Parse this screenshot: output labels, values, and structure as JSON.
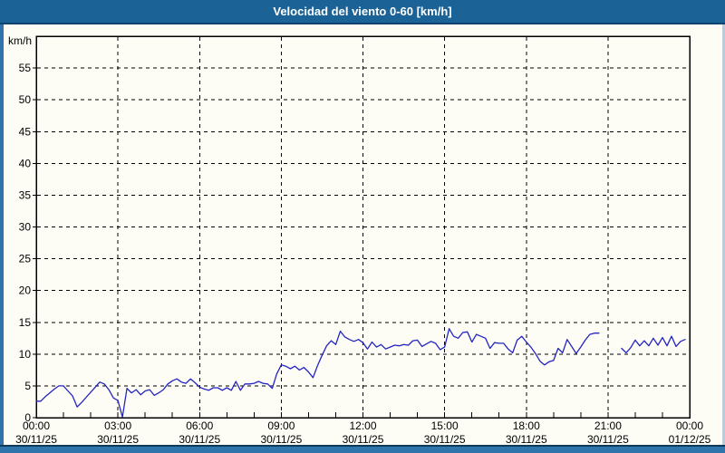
{
  "title_bar": {
    "text": "Velocidad del viento 0-60 [km/h]"
  },
  "colors": {
    "titlebar_bg": "#1b6296",
    "titlebar_text": "#ffffff",
    "window_border": "#2f74ab",
    "background": "#fdfdf6",
    "grid": "#000000",
    "line": "#2424c0"
  },
  "chart_data": {
    "type": "line",
    "title": "Velocidad del viento 0-60 [km/h]",
    "ylabel": "km/h",
    "ylim": [
      0,
      60
    ],
    "ytick_step": 5,
    "yticks": [
      0,
      5,
      10,
      15,
      20,
      25,
      30,
      35,
      40,
      45,
      50,
      55
    ],
    "x_range_hours": [
      0,
      24
    ],
    "x_minor_tick_hours": 1,
    "grid": "dashed, 3-hour vertical and 5 km/h horizontal",
    "legend_position": "none",
    "x_major_ticks": [
      {
        "hour": 0,
        "time": "00:00",
        "date": "30/11/25"
      },
      {
        "hour": 3,
        "time": "03:00",
        "date": "30/11/25"
      },
      {
        "hour": 6,
        "time": "06:00",
        "date": "30/11/25"
      },
      {
        "hour": 9,
        "time": "09:00",
        "date": "30/11/25"
      },
      {
        "hour": 12,
        "time": "12:00",
        "date": "30/11/25"
      },
      {
        "hour": 15,
        "time": "15:00",
        "date": "30/11/25"
      },
      {
        "hour": 18,
        "time": "18:00",
        "date": "30/11/25"
      },
      {
        "hour": 21,
        "time": "21:00",
        "date": "30/11/25"
      },
      {
        "hour": 24,
        "time": "00:00",
        "date": "01/12/25"
      }
    ],
    "series": [
      {
        "name": "Velocidad del viento",
        "color": "#2424c0",
        "units": "km/h",
        "points_format": "[minutes_since_00:00, km/h], null = data gap",
        "points": [
          [
            0,
            2.6
          ],
          [
            10,
            2.6
          ],
          [
            20,
            3.3
          ],
          [
            30,
            3.9
          ],
          [
            40,
            4.5
          ],
          [
            50,
            5.0
          ],
          [
            60,
            5.0
          ],
          [
            70,
            4.2
          ],
          [
            80,
            3.4
          ],
          [
            90,
            1.7
          ],
          [
            100,
            2.4
          ],
          [
            110,
            3.2
          ],
          [
            120,
            4.0
          ],
          [
            130,
            4.8
          ],
          [
            140,
            5.6
          ],
          [
            150,
            5.3
          ],
          [
            160,
            4.4
          ],
          [
            170,
            3.1
          ],
          [
            180,
            2.7
          ],
          [
            190,
            0.1
          ],
          [
            200,
            4.6
          ],
          [
            210,
            3.9
          ],
          [
            220,
            4.4
          ],
          [
            230,
            3.6
          ],
          [
            240,
            4.2
          ],
          [
            250,
            4.4
          ],
          [
            260,
            3.5
          ],
          [
            270,
            3.9
          ],
          [
            280,
            4.4
          ],
          [
            290,
            5.3
          ],
          [
            300,
            5.8
          ],
          [
            310,
            6.1
          ],
          [
            320,
            5.6
          ],
          [
            330,
            5.4
          ],
          [
            340,
            6.1
          ],
          [
            350,
            5.5
          ],
          [
            360,
            4.8
          ],
          [
            370,
            4.5
          ],
          [
            380,
            4.3
          ],
          [
            390,
            4.7
          ],
          [
            400,
            4.7
          ],
          [
            410,
            4.3
          ],
          [
            420,
            4.7
          ],
          [
            430,
            4.3
          ],
          [
            440,
            5.7
          ],
          [
            450,
            4.3
          ],
          [
            460,
            5.3
          ],
          [
            470,
            5.3
          ],
          [
            480,
            5.4
          ],
          [
            490,
            5.7
          ],
          [
            500,
            5.4
          ],
          [
            510,
            5.3
          ],
          [
            520,
            4.6
          ],
          [
            530,
            6.9
          ],
          [
            540,
            8.3
          ],
          [
            550,
            8.1
          ],
          [
            560,
            7.7
          ],
          [
            570,
            8.1
          ],
          [
            580,
            7.5
          ],
          [
            590,
            7.9
          ],
          [
            600,
            7.2
          ],
          [
            610,
            6.3
          ],
          [
            620,
            8.2
          ],
          [
            630,
            9.8
          ],
          [
            640,
            11.3
          ],
          [
            650,
            12.1
          ],
          [
            660,
            11.5
          ],
          [
            670,
            13.6
          ],
          [
            680,
            12.7
          ],
          [
            690,
            12.3
          ],
          [
            700,
            12.0
          ],
          [
            710,
            12.3
          ],
          [
            720,
            11.8
          ],
          [
            730,
            10.8
          ],
          [
            740,
            11.9
          ],
          [
            750,
            11.1
          ],
          [
            760,
            11.5
          ],
          [
            770,
            10.8
          ],
          [
            780,
            11.1
          ],
          [
            790,
            11.4
          ],
          [
            800,
            11.3
          ],
          [
            810,
            11.5
          ],
          [
            820,
            11.4
          ],
          [
            830,
            12.1
          ],
          [
            840,
            12.2
          ],
          [
            850,
            11.2
          ],
          [
            860,
            11.6
          ],
          [
            870,
            12.0
          ],
          [
            880,
            11.7
          ],
          [
            890,
            10.7
          ],
          [
            900,
            11.1
          ],
          [
            910,
            14.0
          ],
          [
            920,
            12.8
          ],
          [
            930,
            12.5
          ],
          [
            940,
            13.4
          ],
          [
            950,
            13.5
          ],
          [
            960,
            11.9
          ],
          [
            970,
            13.1
          ],
          [
            980,
            12.8
          ],
          [
            990,
            12.5
          ],
          [
            1000,
            10.9
          ],
          [
            1010,
            11.8
          ],
          [
            1020,
            11.7
          ],
          [
            1030,
            11.7
          ],
          [
            1040,
            10.8
          ],
          [
            1050,
            10.2
          ],
          [
            1060,
            12.2
          ],
          [
            1070,
            12.8
          ],
          [
            1080,
            11.9
          ],
          [
            1090,
            11.1
          ],
          [
            1100,
            10.1
          ],
          [
            1110,
            8.9
          ],
          [
            1120,
            8.3
          ],
          [
            1130,
            8.8
          ],
          [
            1140,
            9.0
          ],
          [
            1150,
            10.9
          ],
          [
            1160,
            10.2
          ],
          [
            1170,
            12.3
          ],
          [
            1180,
            11.2
          ],
          [
            1190,
            10.1
          ],
          [
            1200,
            11.1
          ],
          [
            1210,
            12.2
          ],
          [
            1220,
            13.1
          ],
          [
            1230,
            13.3
          ],
          [
            1240,
            13.3
          ],
          [
            1250,
            null
          ],
          [
            1260,
            null
          ],
          [
            1270,
            null
          ],
          [
            1280,
            null
          ],
          [
            1290,
            10.9
          ],
          [
            1300,
            10.2
          ],
          [
            1310,
            11.0
          ],
          [
            1320,
            12.2
          ],
          [
            1330,
            11.3
          ],
          [
            1340,
            12.1
          ],
          [
            1350,
            11.3
          ],
          [
            1360,
            12.5
          ],
          [
            1370,
            11.4
          ],
          [
            1380,
            12.6
          ],
          [
            1390,
            11.3
          ],
          [
            1400,
            12.8
          ],
          [
            1410,
            11.2
          ],
          [
            1420,
            12.0
          ],
          [
            1430,
            12.3
          ]
        ]
      }
    ]
  }
}
